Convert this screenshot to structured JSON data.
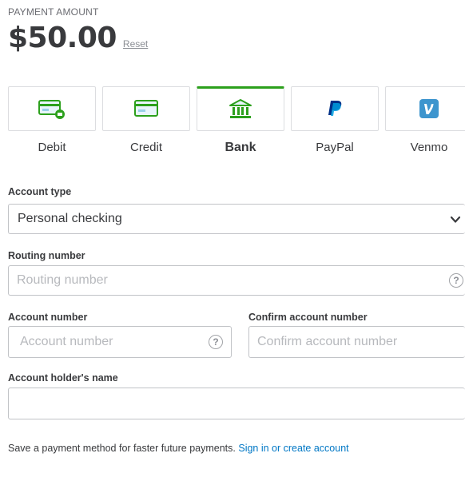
{
  "payment": {
    "label": "PAYMENT AMOUNT",
    "amount": "$50.00",
    "reset": "Reset"
  },
  "methods": [
    {
      "label": "Debit",
      "icon": "debit-card-icon"
    },
    {
      "label": "Credit",
      "icon": "credit-card-icon"
    },
    {
      "label": "Bank",
      "icon": "bank-icon",
      "selected": true
    },
    {
      "label": "PayPal",
      "icon": "paypal-icon"
    },
    {
      "label": "Venmo",
      "icon": "venmo-icon"
    }
  ],
  "form": {
    "account_type": {
      "label": "Account type",
      "value": "Personal checking"
    },
    "routing_number": {
      "label": "Routing number",
      "placeholder": "Routing number",
      "help": "?"
    },
    "account_number": {
      "label": "Account number",
      "placeholder": "Account number",
      "help": "?"
    },
    "confirm_account_number": {
      "label": "Confirm account number",
      "placeholder": "Confirm account number"
    },
    "holder_name": {
      "label": "Account holder's name",
      "placeholder": ""
    }
  },
  "footer": {
    "text": "Save a payment method for faster future payments.",
    "link": "Sign in or create account"
  },
  "colors": {
    "accent_green": "#2ca01c",
    "link_blue": "#0077c5",
    "paypal_blue": "#003087",
    "venmo_blue": "#3d95ce"
  }
}
